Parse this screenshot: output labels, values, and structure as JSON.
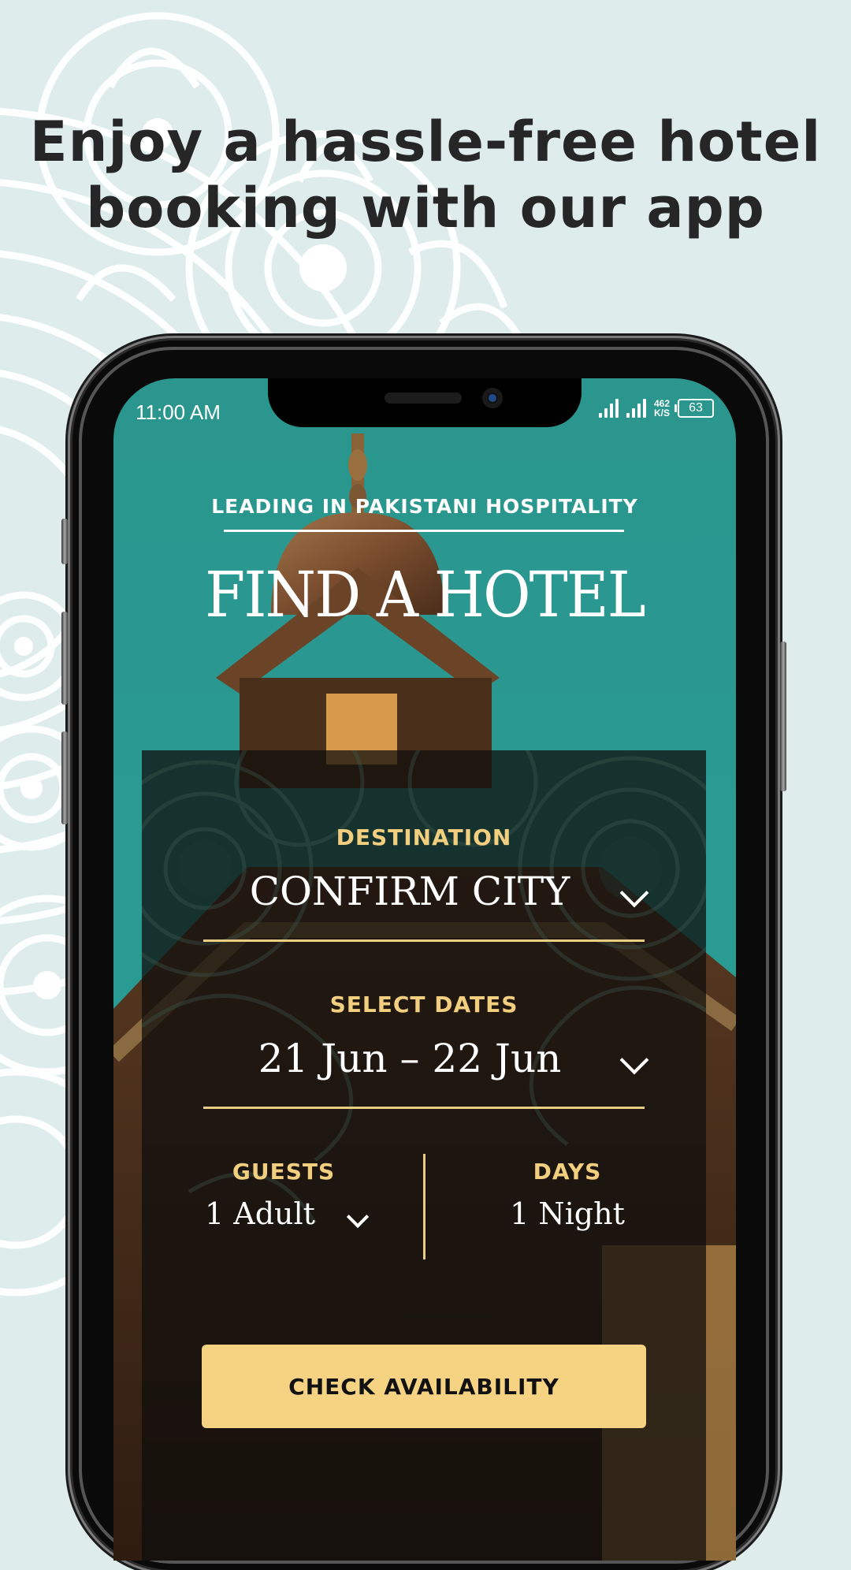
{
  "headline": {
    "line1": "Enjoy a hassle-free hotel",
    "line2": "booking with our app"
  },
  "status_bar": {
    "time": "11:00 AM",
    "net_speed_value": "462",
    "net_speed_unit": "K/S",
    "battery_level": "63"
  },
  "app": {
    "tagline": "LEADING IN PAKISTANI HOSPITALITY",
    "title": "FIND A HOTEL",
    "destination": {
      "label": "DESTINATION",
      "value": "CONFIRM CITY"
    },
    "dates": {
      "label": "SELECT DATES",
      "value": "21 Jun  –  22 Jun"
    },
    "guests": {
      "label": "GUESTS",
      "value": "1 Adult"
    },
    "days": {
      "label": "DAYS",
      "value": "1 Night"
    },
    "cta_label": "CHECK AVAILABILITY"
  },
  "colors": {
    "page_background": "#dfecec",
    "sky_teal": "#2a9a92",
    "accent_gold": "#f2cf7e",
    "button_gold": "#f5d383",
    "headline_text": "#262626"
  }
}
